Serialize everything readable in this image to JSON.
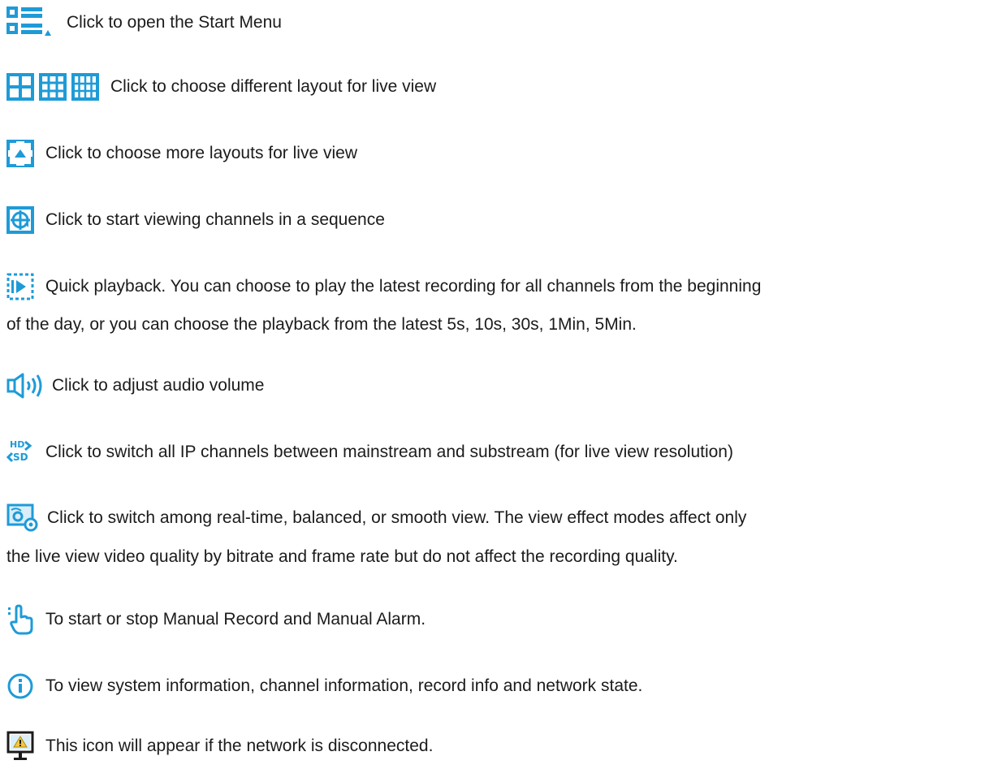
{
  "colors": {
    "accent": "#1e9bd7",
    "text": "#1b1b1b",
    "warning": "#f2c744"
  },
  "rows": [
    {
      "icon": "start-menu-icon",
      "text": "Click to open the Start Menu"
    },
    {
      "icon": "layout-grid-icons",
      "text": "Click to choose different layout for live view"
    },
    {
      "icon": "more-layouts-icon",
      "text": "Click to choose more layouts for live view"
    },
    {
      "icon": "sequence-icon",
      "text": "Click to start viewing channels in a sequence"
    },
    {
      "icon": "quick-playback-icon",
      "text": "Quick playback. You can choose to play the latest recording for all channels from the beginning",
      "text_cont": "of the day, or you can choose the playback from the latest 5s, 10s, 30s, 1Min, 5Min."
    },
    {
      "icon": "volume-icon",
      "text": "Click to adjust audio volume"
    },
    {
      "icon": "hd-sd-icon",
      "text": "Click to switch all IP channels between mainstream and substream (for live view resolution)"
    },
    {
      "icon": "view-effect-icon",
      "text": "Click to switch among real-time, balanced, or smooth view. The view effect modes affect only",
      "text_cont": "the live view video quality by bitrate and frame rate but do not affect the recording quality."
    },
    {
      "icon": "manual-record-hand-icon",
      "text": "To start or stop Manual Record and Manual Alarm."
    },
    {
      "icon": "info-icon",
      "text": "To view system information, channel information, record info and network state."
    },
    {
      "icon": "network-disconnected-icon",
      "text": "This icon will appear if the network is disconnected."
    }
  ],
  "hd_sd_icon_text": {
    "top": "HD",
    "bottom": "SD"
  }
}
